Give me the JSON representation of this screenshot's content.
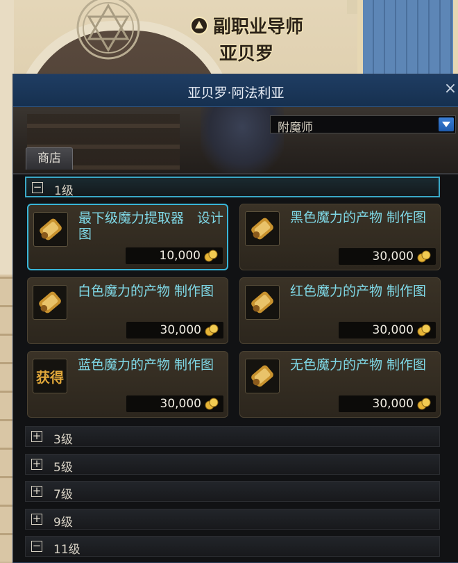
{
  "npc": {
    "title": "副职业导师",
    "name": "亚贝罗"
  },
  "window": {
    "title": "亚贝罗·阿法利亚",
    "close_label": "×"
  },
  "role_select": {
    "value": "附魔师"
  },
  "tabs": {
    "shop": "商店"
  },
  "groups": [
    {
      "label": "1级",
      "toggle": "⊟"
    },
    {
      "label": "3级",
      "toggle": "⊞"
    },
    {
      "label": "5级",
      "toggle": "⊞"
    },
    {
      "label": "7级",
      "toggle": "⊞"
    },
    {
      "label": "9级",
      "toggle": "⊞"
    },
    {
      "label": "11级",
      "toggle": "⊟"
    }
  ],
  "items": [
    {
      "name": "最下级魔力提取器　设计图",
      "price": "10,000",
      "icon": "scroll-icon"
    },
    {
      "name": "黑色魔力的产物 制作图",
      "price": "30,000",
      "icon": "scroll-icon"
    },
    {
      "name": "白色魔力的产物 制作图",
      "price": "30,000",
      "icon": "scroll-icon"
    },
    {
      "name": "红色魔力的产物 制作图",
      "price": "30,000",
      "icon": "scroll-icon"
    },
    {
      "name": "蓝色魔力的产物 制作图",
      "price": "30,000",
      "icon": "obtain-icon",
      "icon_text": "获得"
    },
    {
      "name": "无色魔力的产物 制作图",
      "price": "30,000",
      "icon": "scroll-icon"
    }
  ],
  "colors": {
    "title_bar": "#1f3d63",
    "item_name": "#7fd8e6",
    "selected_border": "#39b6d8",
    "gold": "#e6b436"
  }
}
